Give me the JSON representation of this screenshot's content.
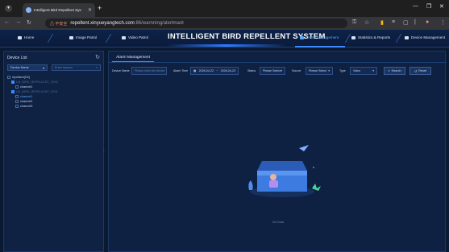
{
  "browser": {
    "tab_title": "Intelligent Bird Repellent Sys",
    "security_warning": "不安全",
    "url_host": "repellent.xinyueyangtech.com",
    "url_path": ":86/warnning/alertmant"
  },
  "topnav": {
    "items": [
      {
        "label": "Home"
      },
      {
        "label": "Image Patrol"
      },
      {
        "label": "Video Patrol"
      },
      {
        "label": "Alarm Management"
      },
      {
        "label": "Statistics & Reports"
      },
      {
        "label": "Device Management"
      }
    ],
    "system_title": "INTELLIGENT BIRD REPELLENT SYSTEM",
    "active_index": 3
  },
  "device_list": {
    "title": "Device List",
    "select_value": "Device Name",
    "search_placeholder": "Enter keywor",
    "tree": [
      {
        "label": "repellent(DZ)",
        "checked": false,
        "indent": 0,
        "style": "normal"
      },
      {
        "label": "LM_BIRD_REPELLENT_S000",
        "checked": true,
        "indent": 1,
        "style": "dim"
      },
      {
        "label": "channel1",
        "checked": false,
        "indent": 2,
        "style": "normal"
      },
      {
        "label": "LM_BIRD_REPELLENT_S001",
        "checked": true,
        "indent": 1,
        "style": "dim"
      },
      {
        "label": "channel1",
        "checked": false,
        "indent": 2,
        "style": "blue"
      },
      {
        "label": "channel2",
        "checked": false,
        "indent": 2,
        "style": "normal"
      },
      {
        "label": "channel3",
        "checked": false,
        "indent": 2,
        "style": "normal"
      }
    ]
  },
  "main": {
    "tab_label": "Alarm Management",
    "filters": {
      "device_name_label": "Device Name",
      "device_name_placeholder": "Please enter the device",
      "alarm_time_label": "Alarm Time",
      "date_start": "2026-04-22",
      "date_sep": "~",
      "date_end": "2026-04-23",
      "status_label": "Status",
      "status_placeholder": "Please Select",
      "source_label": "Source",
      "source_placeholder": "Please Select",
      "type_label": "Type",
      "type_value": "Video",
      "search_label": "Search",
      "reset_label": "Reset"
    },
    "no_data": "No Data"
  },
  "colors": {
    "accent": "#3d8bff",
    "panel_bg": "#0e2143",
    "page_bg": "#0b1a33"
  }
}
